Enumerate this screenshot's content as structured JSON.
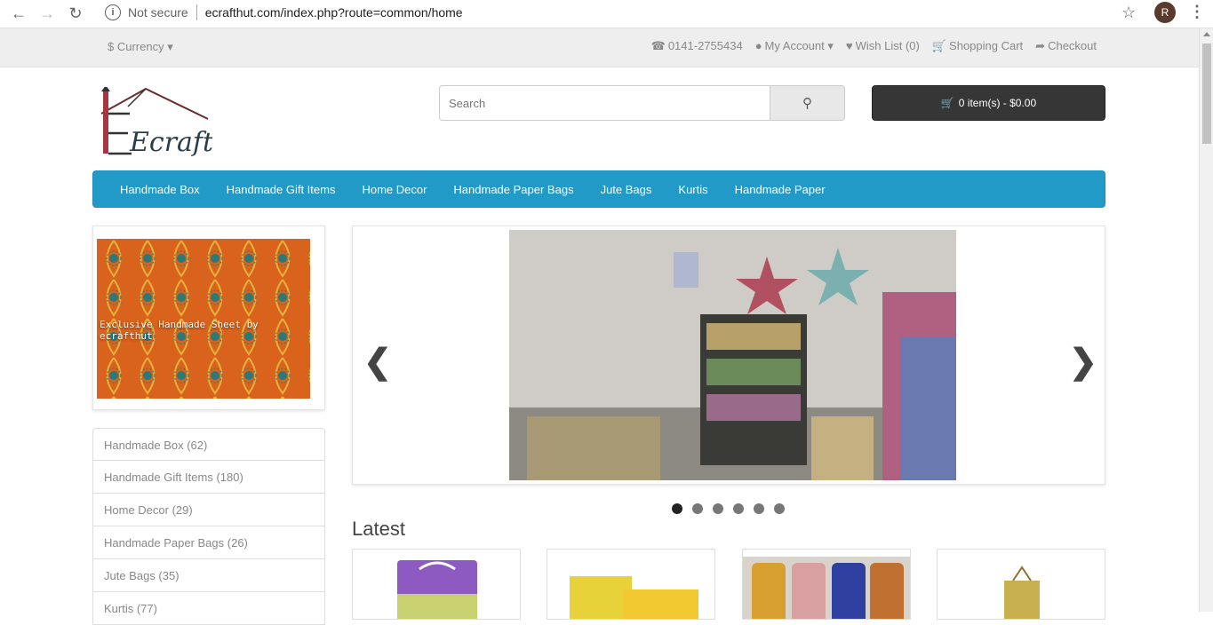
{
  "browser": {
    "security_label": "Not secure",
    "url": "ecrafthut.com/index.php?route=common/home",
    "profile_initial": "R"
  },
  "topbar": {
    "currency_label": "$ Currency",
    "phone": "0141-2755434",
    "my_account": "My Account",
    "wish_list": "Wish List (0)",
    "shopping_cart": "Shopping Cart",
    "checkout": "Checkout"
  },
  "header": {
    "logo_text": "Ecraft",
    "search_placeholder": "Search",
    "cart_label": "0 item(s) - $0.00"
  },
  "menu": {
    "items": [
      "Handmade Box",
      "Handmade Gift Items",
      "Home Decor",
      "Handmade Paper Bags",
      "Jute Bags",
      "Kurtis",
      "Handmade Paper"
    ]
  },
  "banner": {
    "caption": "Exclusive Handmade Sheet by ecrafthut"
  },
  "categories": [
    "Handmade Box (62)",
    "Handmade Gift Items (180)",
    "Home Decor (29)",
    "Handmade Paper Bags (26)",
    "Jute Bags (35)",
    "Kurtis (77)"
  ],
  "slideshow": {
    "total_slides": 6,
    "active_slide": 1
  },
  "latest": {
    "heading": "Latest"
  }
}
